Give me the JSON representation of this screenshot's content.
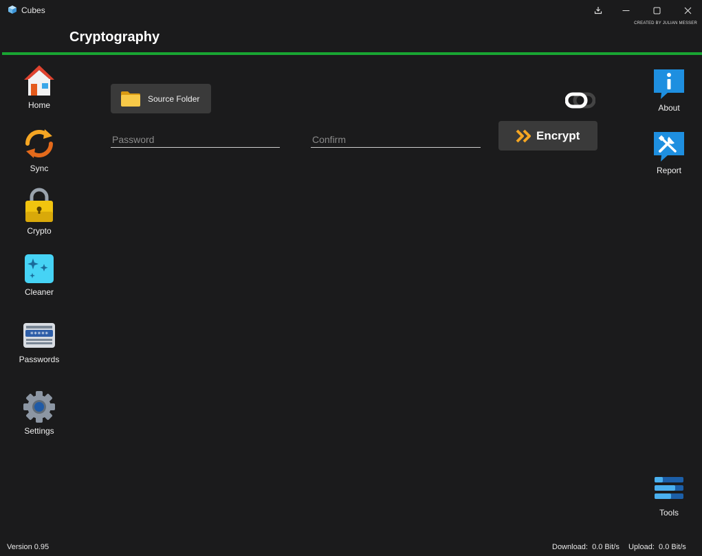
{
  "window": {
    "title": "Cubes",
    "credit": "CREATED BY JULIAN MESSER",
    "controls": [
      "download-icon",
      "minimize-icon",
      "maximize-icon",
      "close-icon"
    ]
  },
  "page": {
    "title": "Cryptography"
  },
  "colors": {
    "accent": "#19a532",
    "background": "#1b1b1c",
    "button": "#3a3a3a"
  },
  "sidebar_left": {
    "items": [
      {
        "label": "Home",
        "icon": "home-icon"
      },
      {
        "label": "Sync",
        "icon": "sync-icon"
      },
      {
        "label": "Crypto",
        "icon": "lock-icon"
      },
      {
        "label": "Cleaner",
        "icon": "sparkle-icon"
      },
      {
        "label": "Passwords",
        "icon": "password-keyboard-icon"
      },
      {
        "label": "Settings",
        "icon": "gear-icon"
      }
    ]
  },
  "sidebar_right": {
    "items": [
      {
        "label": "About",
        "icon": "info-icon"
      },
      {
        "label": "Report",
        "icon": "tools-report-icon"
      },
      {
        "label": "Tools",
        "icon": "list-bars-icon"
      }
    ]
  },
  "crypto": {
    "source_folder_label": "Source Folder",
    "password_placeholder": "Password",
    "confirm_placeholder": "Confirm",
    "encrypt_label": "Encrypt",
    "mode_toggle": "link-toggle-icon"
  },
  "status": {
    "version": "Version 0.95",
    "download": "Download:  0.0 Bit/s",
    "upload": "Upload:  0.0 Bit/s"
  }
}
